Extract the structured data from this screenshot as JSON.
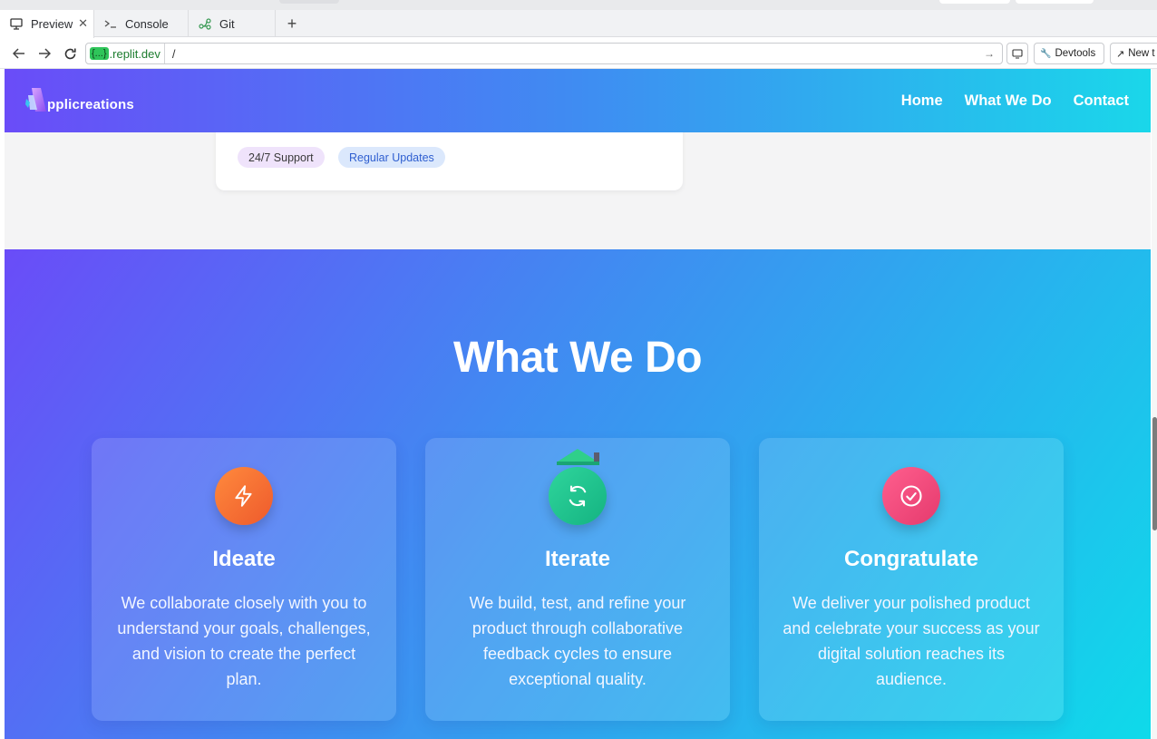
{
  "browser": {
    "tabs": [
      {
        "label": "Preview",
        "icon": "monitor-icon",
        "active": true,
        "closable": true
      },
      {
        "label": "Console",
        "icon": "terminal-icon",
        "active": false
      },
      {
        "label": "Git",
        "icon": "git-branch-icon",
        "active": false
      }
    ],
    "new_tab_label": "+",
    "url_host_badge": "{...}",
    "url_host": ".replit.dev",
    "url_path": "/",
    "devtools_label": "Devtools",
    "new_tab_button_label": "New t"
  },
  "site": {
    "logo_text": "pplicreations",
    "nav": [
      "Home",
      "What We Do",
      "Contact"
    ],
    "tags": [
      "24/7 Support",
      "Regular Updates"
    ],
    "section_title": "What We Do",
    "features": [
      {
        "title": "Ideate",
        "text": "We collaborate closely with you to understand your goals, challenges, and vision to create the perfect plan.",
        "icon": "lightning-icon",
        "color": "#f4723a"
      },
      {
        "title": "Iterate",
        "text": "We build, test, and refine your product through collaborative feedback cycles to ensure exceptional quality.",
        "icon": "refresh-icon",
        "color": "#22c28f"
      },
      {
        "title": "Congratulate",
        "text": "We deliver your polished product and celebrate your success as your digital solution reaches its audience.",
        "icon": "check-circle-icon",
        "color": "#ec4a7a"
      }
    ]
  },
  "colors": {
    "header_gradient_start": "#6a4cf8",
    "header_gradient_end": "#1ad7ea",
    "tag_purple_bg": "#efe3fb",
    "tag_blue_bg": "#dbe8fc"
  }
}
